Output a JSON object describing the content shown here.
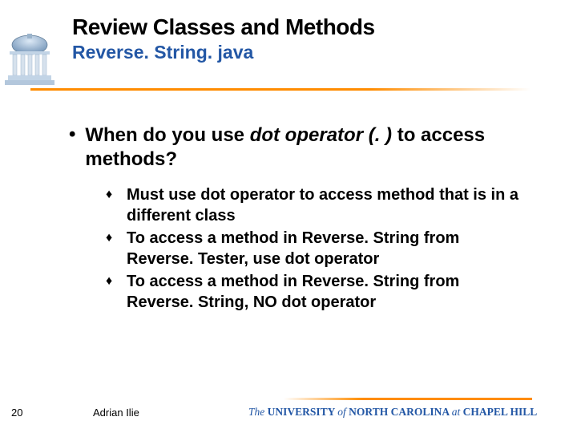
{
  "header": {
    "title": "Review Classes and Methods",
    "subtitle": "Reverse. String. java"
  },
  "content": {
    "question_pre": "When do you use ",
    "question_em": "dot operator (. )",
    "question_post": " to access methods?",
    "items": [
      "Must use dot operator to access method that is in a different class",
      "To access a method in Reverse. String from Reverse. Tester, use dot operator",
      "To access a method in Reverse. String from Reverse. String, NO dot operator"
    ]
  },
  "footer": {
    "page": "20",
    "author": "Adrian Ilie",
    "affil_the": "The",
    "affil_univ": " UNIVERSITY ",
    "affil_of": "of",
    "affil_nc": " NORTH  CAROLINA ",
    "affil_at": "at",
    "affil_ch": " CHAPEL  HILL"
  }
}
